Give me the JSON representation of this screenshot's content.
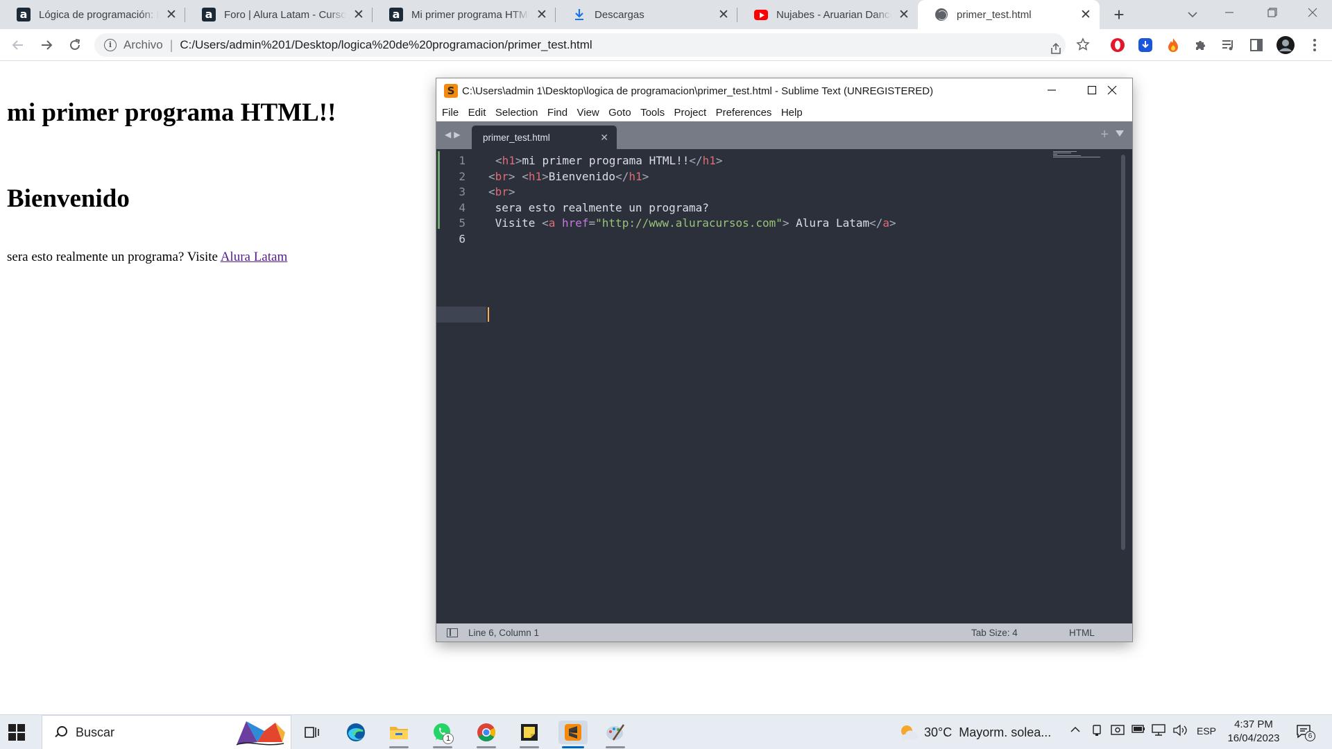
{
  "browser": {
    "tabs": [
      {
        "title": "Lógica de programación: Primeros pasos",
        "favicon": "alura-icon",
        "active": false
      },
      {
        "title": "Foro | Alura Latam - Cursos online",
        "favicon": "alura-icon",
        "active": false
      },
      {
        "title": "Mi primer programa HTML",
        "favicon": "alura-icon",
        "active": false
      },
      {
        "title": "Descargas",
        "favicon": "download-icon",
        "active": false
      },
      {
        "title": "Nujabes - Aruarian Dance (Samurai",
        "favicon": "youtube-icon",
        "active": false
      },
      {
        "title": "primer_test.html",
        "favicon": "globe-icon",
        "active": true
      }
    ],
    "omnibox": {
      "scheme_label": "Archivo",
      "separator": "|",
      "url": "C:/Users/admin%201/Desktop/logica%20de%20programacion/primer_test.html"
    },
    "profile_color": "#1a1a1a"
  },
  "webpage": {
    "heading1": "mi primer programa HTML!!",
    "heading2": "Bienvenido",
    "paragraph_text": "sera esto realmente un programa? Visite ",
    "link_text": "Alura Latam",
    "link_color": "#551a8b"
  },
  "sublime": {
    "title": "C:\\Users\\admin 1\\Desktop\\logica de programacion\\primer_test.html - Sublime Text (UNREGISTERED)",
    "app_icon_letter": "S",
    "menu": [
      "File",
      "Edit",
      "Selection",
      "Find",
      "View",
      "Goto",
      "Tools",
      "Project",
      "Preferences",
      "Help"
    ],
    "tab_name": "primer_test.html",
    "line_numbers": [
      "1",
      "2",
      "3",
      "4",
      "5",
      "6"
    ],
    "code": {
      "l1": {
        "t1": "<",
        "t2": "h1",
        "t3": ">",
        "text": "mi primer programa HTML!!",
        "t4": "</",
        "t5": "h1",
        "t6": ">"
      },
      "l2": {
        "a1": "<",
        "a2": "br",
        "a3": ">",
        "b1": "<",
        "b2": "h1",
        "b3": ">",
        "text": "Bienvenido",
        "c1": "</",
        "c2": "h1",
        "c3": ">"
      },
      "l3": {
        "a1": "<",
        "a2": "br",
        "a3": ">"
      },
      "l4": {
        "text": " sera esto realmente un programa?"
      },
      "l5": {
        "pre": " Visite ",
        "a1": "<",
        "a2": "a",
        "attr": "href",
        "eq": "=",
        "val": "\"http://www.aluracursos.com\"",
        "a3": ">",
        "text": " Alura Latam",
        "c1": "</",
        "c2": "a",
        "c3": ">"
      }
    },
    "status": {
      "position": "Line 6, Column 1",
      "tab_size": "Tab Size: 4",
      "syntax": "HTML"
    },
    "colors": {
      "background": "#2b303b",
      "tag": "#e06c75",
      "string": "#98c379",
      "attribute": "#c678dd",
      "caret": "#f9ae58"
    }
  },
  "taskbar": {
    "search_placeholder": "Buscar",
    "weather_temp": "30°C",
    "weather_desc": "Mayorm. solea...",
    "language": "ESP",
    "time": "4:37 PM",
    "date": "16/04/2023",
    "whatsapp_badge": "1",
    "notifications_badge": "6"
  }
}
